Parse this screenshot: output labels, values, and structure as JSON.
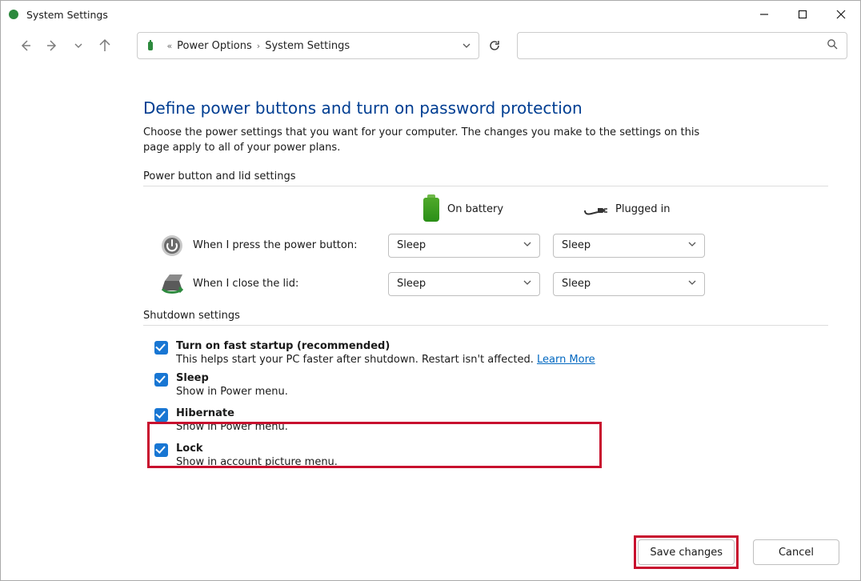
{
  "window": {
    "title": "System Settings"
  },
  "breadcrumb": {
    "item1": "Power Options",
    "item2": "System Settings"
  },
  "page": {
    "heading": "Define power buttons and turn on password protection",
    "intro": "Choose the power settings that you want for your computer. The changes you make to the settings on this page apply to all of your power plans."
  },
  "section1": {
    "label": "Power button and lid settings",
    "col_battery": "On battery",
    "col_plugged": "Plugged in",
    "row_power_label": "When I press the power button:",
    "row_power_battery": "Sleep",
    "row_power_plugged": "Sleep",
    "row_lid_label": "When I close the lid:",
    "row_lid_battery": "Sleep",
    "row_lid_plugged": "Sleep"
  },
  "section2": {
    "label": "Shutdown settings",
    "fast_startup_title": "Turn on fast startup (recommended)",
    "fast_startup_desc": "This helps start your PC faster after shutdown. Restart isn't affected. ",
    "fast_startup_link": "Learn More",
    "sleep_title": "Sleep",
    "sleep_desc": "Show in Power menu.",
    "hibernate_title": "Hibernate",
    "hibernate_desc": "Show in Power menu.",
    "lock_title": "Lock",
    "lock_desc": "Show in account picture menu."
  },
  "footer": {
    "save": "Save changes",
    "cancel": "Cancel"
  }
}
